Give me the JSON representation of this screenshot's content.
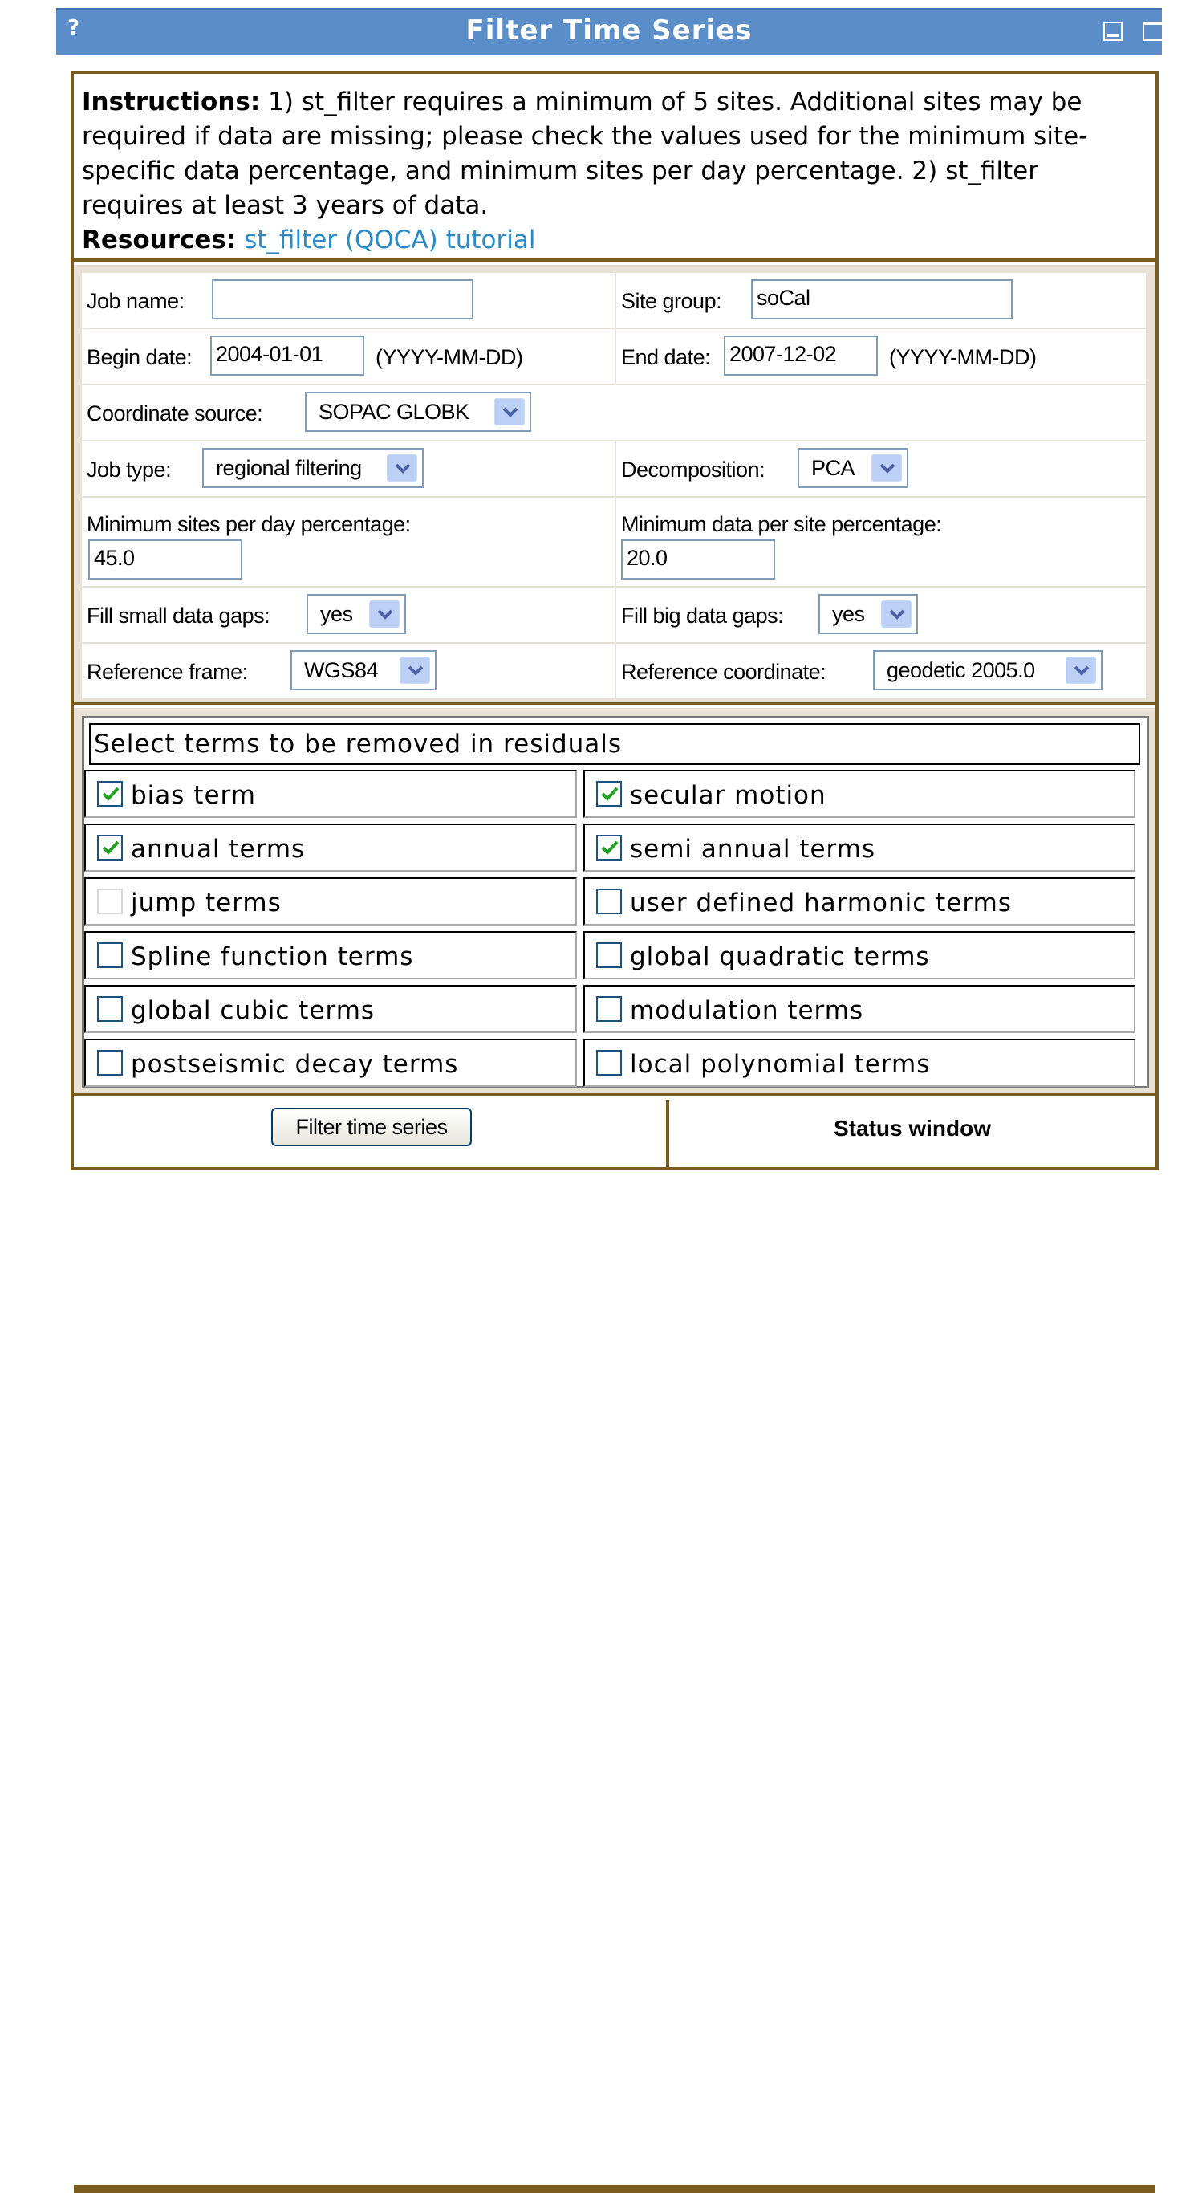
{
  "window": {
    "title": "Filter Time Series",
    "help_icon": "?"
  },
  "instructions": {
    "label": "Instructions:",
    "text": " 1) st_filter requires a minimum of 5 sites. Additional sites may be required if data are missing; please check the values used for the minimum site-specific data percentage, and minimum sites per day percentage. 2) st_filter requires at least 3 years of data.",
    "resources_label": "Resources:",
    "tutorial_link": "st_filter (QOCA) tutorial"
  },
  "form": {
    "job_name": {
      "label": "Job name:",
      "value": ""
    },
    "site_group": {
      "label": "Site group:",
      "value": "soCal"
    },
    "begin_date": {
      "label": "Begin date:",
      "value": "2004-01-01",
      "hint": "(YYYY-MM-DD)"
    },
    "end_date": {
      "label": "End date:",
      "value": "2007-12-02",
      "hint": "(YYYY-MM-DD)"
    },
    "coordinate_source": {
      "label": "Coordinate source:",
      "value": "SOPAC GLOBK"
    },
    "job_type": {
      "label": "Job type:",
      "value": "regional filtering"
    },
    "decomposition": {
      "label": "Decomposition:",
      "value": "PCA"
    },
    "min_sites_per_day": {
      "label": "Minimum sites per day percentage:",
      "value": "45.0"
    },
    "min_data_per_site": {
      "label": "Minimum data per site percentage:",
      "value": "20.0"
    },
    "fill_small_gaps": {
      "label": "Fill small data gaps:",
      "value": "yes"
    },
    "fill_big_gaps": {
      "label": "Fill big data gaps:",
      "value": "yes"
    },
    "reference_frame": {
      "label": "Reference frame:",
      "value": "WGS84"
    },
    "reference_coordinate": {
      "label": "Reference coordinate:",
      "value": "geodetic 2005.0"
    }
  },
  "terms": {
    "header": "Select terms to be removed in residuals",
    "items": [
      {
        "label": "bias term",
        "checked": true,
        "enabled": true
      },
      {
        "label": "secular motion",
        "checked": true,
        "enabled": true
      },
      {
        "label": "annual terms",
        "checked": true,
        "enabled": true
      },
      {
        "label": "semi annual terms",
        "checked": true,
        "enabled": true
      },
      {
        "label": "jump terms",
        "checked": false,
        "enabled": false
      },
      {
        "label": "user defined harmonic terms",
        "checked": false,
        "enabled": true
      },
      {
        "label": "Spline function terms",
        "checked": false,
        "enabled": true
      },
      {
        "label": "global quadratic terms",
        "checked": false,
        "enabled": true
      },
      {
        "label": "global cubic terms",
        "checked": false,
        "enabled": true
      },
      {
        "label": "modulation terms",
        "checked": false,
        "enabled": true
      },
      {
        "label": "postseismic decay terms",
        "checked": false,
        "enabled": true
      },
      {
        "label": "local polynomial terms",
        "checked": false,
        "enabled": true
      }
    ]
  },
  "actions": {
    "filter_button": "Filter time series",
    "status_window": "Status window"
  },
  "colors": {
    "titlebar": "#5b8ec9",
    "panel_border": "#7a5c1e",
    "panel_background": "#e7e2d3",
    "link": "#2a8ac8",
    "check": "#21a121"
  }
}
